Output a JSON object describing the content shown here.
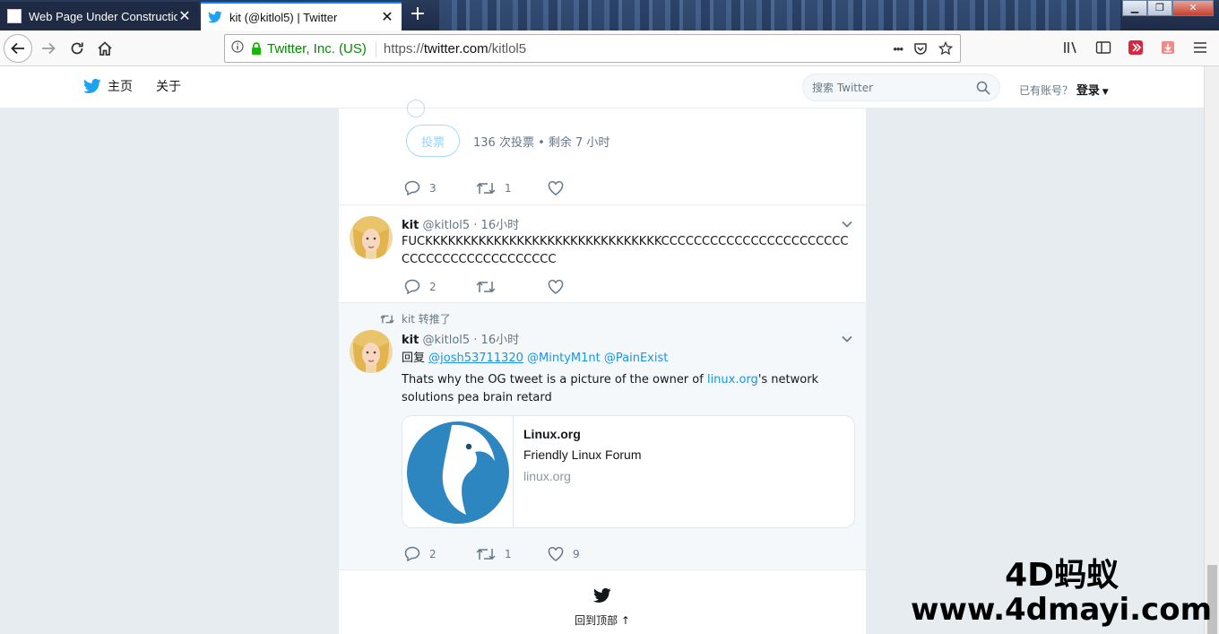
{
  "browser": {
    "tabs": [
      {
        "title": "Web Page Under Construction",
        "active": false
      },
      {
        "title": "kit (@kitlol5) | Twitter",
        "active": true
      }
    ],
    "new_tab": "+",
    "window_controls": {
      "minimize": "▁",
      "maximize": "❐",
      "close": "✕"
    },
    "identity": "Twitter, Inc. (US)",
    "url_prefix": "https://",
    "url_domain": "twitter.com",
    "url_path": "/kitlol5",
    "page_actions": "•••"
  },
  "twitter": {
    "nav": {
      "home": "主页",
      "about": "关于"
    },
    "search_placeholder": "搜索 Twitter",
    "login_prompt": "已有账号？",
    "login": "登录"
  },
  "tweet1": {
    "vote_button": "投票",
    "poll_meta": "136 次投票 • 剩余 7 小时",
    "reply_count": "3",
    "retweet_count": "1",
    "like_count": ""
  },
  "tweet2": {
    "name": "kit",
    "handle": "@kitlol5",
    "time": "· 16小时",
    "text": "FUCKKKKKKKKKKKKKKKKKKKKKKKKKKKKKKKCCCCCCCCCCCCCCCCCCCCCCCCCCCCCCCCCCCCCCCCCC",
    "reply_count": "2",
    "retweet_count": "",
    "like_count": ""
  },
  "tweet3": {
    "retweeted_by": "kit 转推了",
    "name": "kit",
    "handle": "@kitlol5",
    "time": "· 16小时",
    "reply_prefix": "回复",
    "mention1": "@josh53711320",
    "mention2": "@MintyM1nt",
    "mention3": "@PainExist",
    "text_before": "Thats why the OG tweet is a picture of the owner of ",
    "text_link": "linux.org",
    "text_after": "'s network solutions pea brain retard",
    "card": {
      "title": "Linux.org",
      "description": "Friendly Linux Forum",
      "domain": "linux.org"
    },
    "reply_count": "2",
    "retweet_count": "1",
    "like_count": "9"
  },
  "back_to_top": "回到顶部 ↑",
  "watermark": {
    "line1": "4D蚂蚁",
    "line2": "www.4dmayi.com"
  },
  "colors": {
    "twitter_blue": "#1da1f2",
    "link": "#1b95e0",
    "secure_green": "#058b00"
  }
}
